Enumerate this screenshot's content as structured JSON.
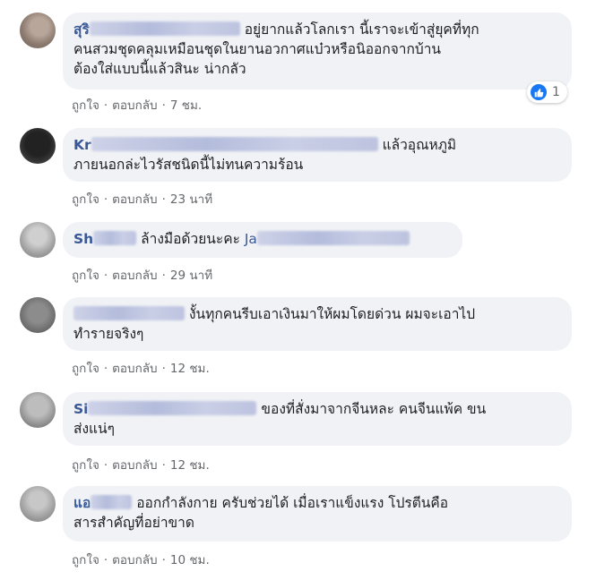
{
  "comments": [
    {
      "name": "สุริ",
      "text": "อยู่ยากแล้วโลกเรา นี้เราจะเข้าสู่ยุคที่ทุกคนสวมชุดคลุมเหมือนชุดในยานอวกาศแบ๋วหรือนิออกจากบ้านต้องใส่แบบนี้แล้วสินะ น่ากลัว",
      "line1": "อยู่ยากแล้วโลกเรา นี้เราจะเข้าสู่ยุคที่ทุก",
      "line2": "คนสวมชุดคลุมเหมือนชุดในยานอวกาศแบ๋วหรือนิออกจากบ้าน",
      "line3": "ต้องใส่แบบนี้แล้วสินะ น่ากลัว",
      "like": "ถูกใจ",
      "reply": "ตอบกลับ",
      "time": "7 ชม.",
      "reactions": "1"
    },
    {
      "name": "Kr",
      "line1": "แล้วอุณหภูมิ",
      "line2": "ภายนอกล่ะไวรัสชนิดนี้ไม่ทนความร้อน",
      "like": "ถูกใจ",
      "reply": "ตอบกลับ",
      "time": "23 นาที"
    },
    {
      "name": "Sh",
      "line1": "ล้างมือด้วยนะคะ",
      "tag": "Ja",
      "like": "ถูกใจ",
      "reply": "ตอบกลับ",
      "time": "29 นาที"
    },
    {
      "name": "",
      "line1": "งั้นทุกคนรีบเอาเงินมาให้ผมโดยด่วน ผมจะเอาไป",
      "line2": "ทำรายจริงๆ",
      "like": "ถูกใจ",
      "reply": "ตอบกลับ",
      "time": "12 ชม."
    },
    {
      "name": "Si",
      "line1": "ของที่สั่งมาจากจีนหละ คนจีนแพ้ค ขน",
      "line2": "ส่งแน่ๆ",
      "like": "ถูกใจ",
      "reply": "ตอบกลับ",
      "time": "12 ชม."
    },
    {
      "name": "แอ",
      "line1": "ออกกำลังกาย ครับช่วยได้ เมื่อเราแข็งแรง โปรตีนคือ",
      "line2": "สารสำคัญที่อย่าขาด",
      "like": "ถูกใจ",
      "reply": "ตอบกลับ",
      "time": "10 ชม."
    }
  ],
  "separator": "·",
  "colors": {
    "bubble": "#f0f2f5",
    "name": "#385898",
    "meta": "#65676b",
    "like_badge": "#1877f2"
  },
  "icons": {
    "reaction": "like-thumb-icon"
  }
}
